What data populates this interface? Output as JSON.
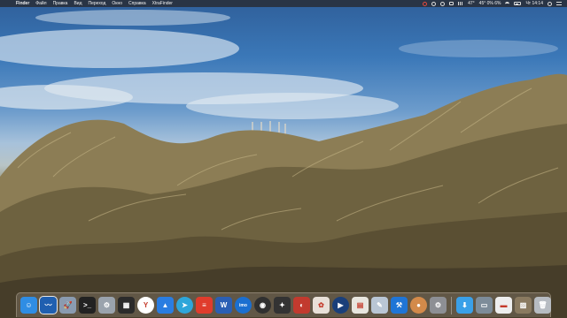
{
  "menubar": {
    "apple_glyph": "",
    "app_name": "Finder",
    "menus": [
      "Файл",
      "Правка",
      "Вид",
      "Переход",
      "Окно",
      "Справка",
      "XtraFinder"
    ],
    "status_temp": "47°",
    "status_stats": "45° 0% 6%",
    "clock": "Чт 14:14"
  },
  "dock": {
    "apps": [
      {
        "name": "Finder",
        "icon": "finder-icon",
        "color": "#2f8de4",
        "glyph": "☺"
      },
      {
        "name": "Activity Monitor",
        "icon": "activity-monitor-icon",
        "color": "#1f5fb0",
        "glyph": "〰"
      },
      {
        "name": "Launchpad",
        "icon": "launchpad-icon",
        "color": "#8a9bb0",
        "glyph": "🚀"
      },
      {
        "name": "Terminal",
        "icon": "terminal-icon",
        "color": "#222222",
        "glyph": ">_"
      },
      {
        "name": "Automator",
        "icon": "automator-icon",
        "color": "#9aa3ad",
        "glyph": "⚙"
      },
      {
        "name": "Task Manager",
        "icon": "grid-app-icon",
        "color": "#2b2b2b",
        "glyph": "▦"
      },
      {
        "name": "Yandex Browser",
        "icon": "yandex-browser-icon",
        "color": "#ffffff",
        "glyph": "Y"
      },
      {
        "name": "Safari",
        "icon": "safari-icon",
        "color": "#2a7de1",
        "glyph": "▲"
      },
      {
        "name": "Telegram",
        "icon": "telegram-icon",
        "color": "#2ea6da",
        "glyph": "➤"
      },
      {
        "name": "Todoist",
        "icon": "todoist-icon",
        "color": "#e03c2c",
        "glyph": "≡"
      },
      {
        "name": "Microsoft Word",
        "icon": "word-icon",
        "color": "#2b5fb4",
        "glyph": "W"
      },
      {
        "name": "IMO",
        "icon": "imo-icon",
        "color": "#1b6fd0",
        "glyph": "imo"
      },
      {
        "name": "OBS",
        "icon": "obs-icon",
        "color": "#303030",
        "glyph": "◉"
      },
      {
        "name": "Final Cut Pro",
        "icon": "final-cut-icon",
        "color": "#333333",
        "glyph": "✦"
      },
      {
        "name": "Photo Booth",
        "icon": "photo-app-icon",
        "color": "#c23a2e",
        "glyph": "◐"
      },
      {
        "name": "Pinwheel",
        "icon": "pinwheel-icon",
        "color": "#e8e0d8",
        "glyph": "✿"
      },
      {
        "name": "QuickTime Player",
        "icon": "quicktime-icon",
        "color": "#1a3f7a",
        "glyph": "▶"
      },
      {
        "name": "Notes",
        "icon": "notes-icon",
        "color": "#e8e6df",
        "glyph": "▤"
      },
      {
        "name": "Preview",
        "icon": "preview-icon",
        "color": "#b9c6d5",
        "glyph": "✎"
      },
      {
        "name": "Xcode",
        "icon": "xcode-icon",
        "color": "#1f75d6",
        "glyph": "⚒"
      },
      {
        "name": "Pixelmator",
        "icon": "pixelmator-icon",
        "color": "#d38a4a",
        "glyph": "●"
      },
      {
        "name": "System Preferences",
        "icon": "gear-icon",
        "color": "#8d8f94",
        "glyph": "⚙"
      }
    ],
    "docs": [
      {
        "name": "Downloads",
        "icon": "downloads-folder-icon",
        "color": "#3aa0e8",
        "glyph": "⬇"
      },
      {
        "name": "Screenshot",
        "icon": "screenshot-thumb-icon",
        "color": "#7d8c99",
        "glyph": "▭"
      },
      {
        "name": "Document",
        "icon": "document-thumb-icon",
        "color": "#eeeeee",
        "glyph": "▬"
      },
      {
        "name": "Photo",
        "icon": "photo-thumb-icon",
        "color": "#8a7a60",
        "glyph": "▨"
      },
      {
        "name": "Trash",
        "icon": "trash-icon",
        "color": "#b7bcc2",
        "glyph": "🗑"
      }
    ]
  }
}
